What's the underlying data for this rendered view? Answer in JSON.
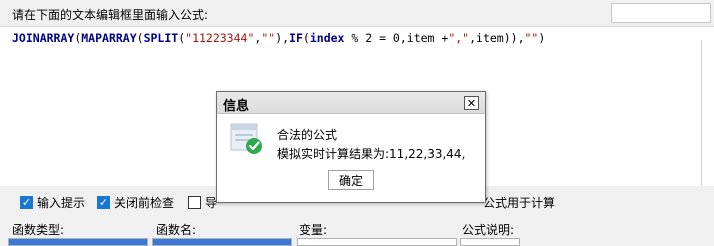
{
  "header": {
    "prompt": "请在下面的文本编辑框里面输入公式:"
  },
  "formula": {
    "text": "JOINARRAY(MAPARRAY(SPLIT(\"11223344\",\"\"),IF(index % 2 = 0,item +\",\",item)),\"\")",
    "tokens": [
      {
        "t": "JOINARRAY",
        "c": "kw"
      },
      {
        "t": "(",
        "c": "op"
      },
      {
        "t": "MAPARRAY",
        "c": "kw"
      },
      {
        "t": "(",
        "c": "op"
      },
      {
        "t": "SPLIT",
        "c": "kw"
      },
      {
        "t": "(",
        "c": "op"
      },
      {
        "t": "\"11223344\"",
        "c": "str"
      },
      {
        "t": ",",
        "c": "op"
      },
      {
        "t": "\"\"",
        "c": "str"
      },
      {
        "t": "),",
        "c": "op"
      },
      {
        "t": "IF",
        "c": "kw"
      },
      {
        "t": "(",
        "c": "op"
      },
      {
        "t": "index",
        "c": "kw"
      },
      {
        "t": " % 2 = 0,item +",
        "c": "op"
      },
      {
        "t": "\",\"",
        "c": "str"
      },
      {
        "t": ",item)),",
        "c": "op"
      },
      {
        "t": "\"\"",
        "c": "str"
      },
      {
        "t": ")",
        "c": "op"
      }
    ]
  },
  "toolbar": {
    "input_hint": "输入提示",
    "check_on_close": "关闭前检查",
    "third_partial": "导",
    "right_partial": "公式用于计算"
  },
  "columns": {
    "func_type": "函数类型:",
    "func_name": "函数名:",
    "variables": "变量:",
    "formula_desc": "公式说明:"
  },
  "dialog": {
    "title": "信息",
    "close_glyph": "✕",
    "line1": "合法的公式",
    "line2": "模拟实时计算结果为:11,22,33,44,",
    "ok_label": "确定"
  },
  "colors": {
    "accent": "#1976d2",
    "success": "#2eaa4e",
    "keyword": "#00008b",
    "string": "#a31515"
  }
}
